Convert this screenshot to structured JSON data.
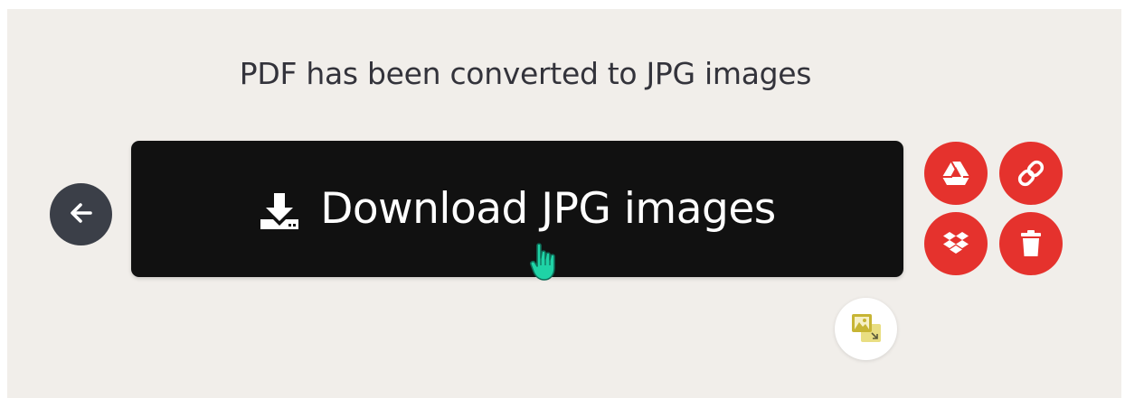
{
  "page": {
    "title": "PDF has been converted to JPG images"
  },
  "actions": {
    "download_label": "Download JPG images",
    "back_icon": "arrow-left-icon",
    "download_icon": "download-icon"
  },
  "side_actions": [
    {
      "name": "google-drive",
      "icon": "google-drive-icon"
    },
    {
      "name": "copy-link",
      "icon": "link-icon"
    },
    {
      "name": "dropbox",
      "icon": "dropbox-icon"
    },
    {
      "name": "delete",
      "icon": "trash-icon"
    }
  ],
  "extra_action": {
    "icon": "image-convert-icon"
  },
  "colors": {
    "background": "#f1eeea",
    "primary_button": "#111111",
    "accent_red": "#e5322d",
    "back_button": "#3b3f48",
    "cursor": "#1fd3a6"
  }
}
